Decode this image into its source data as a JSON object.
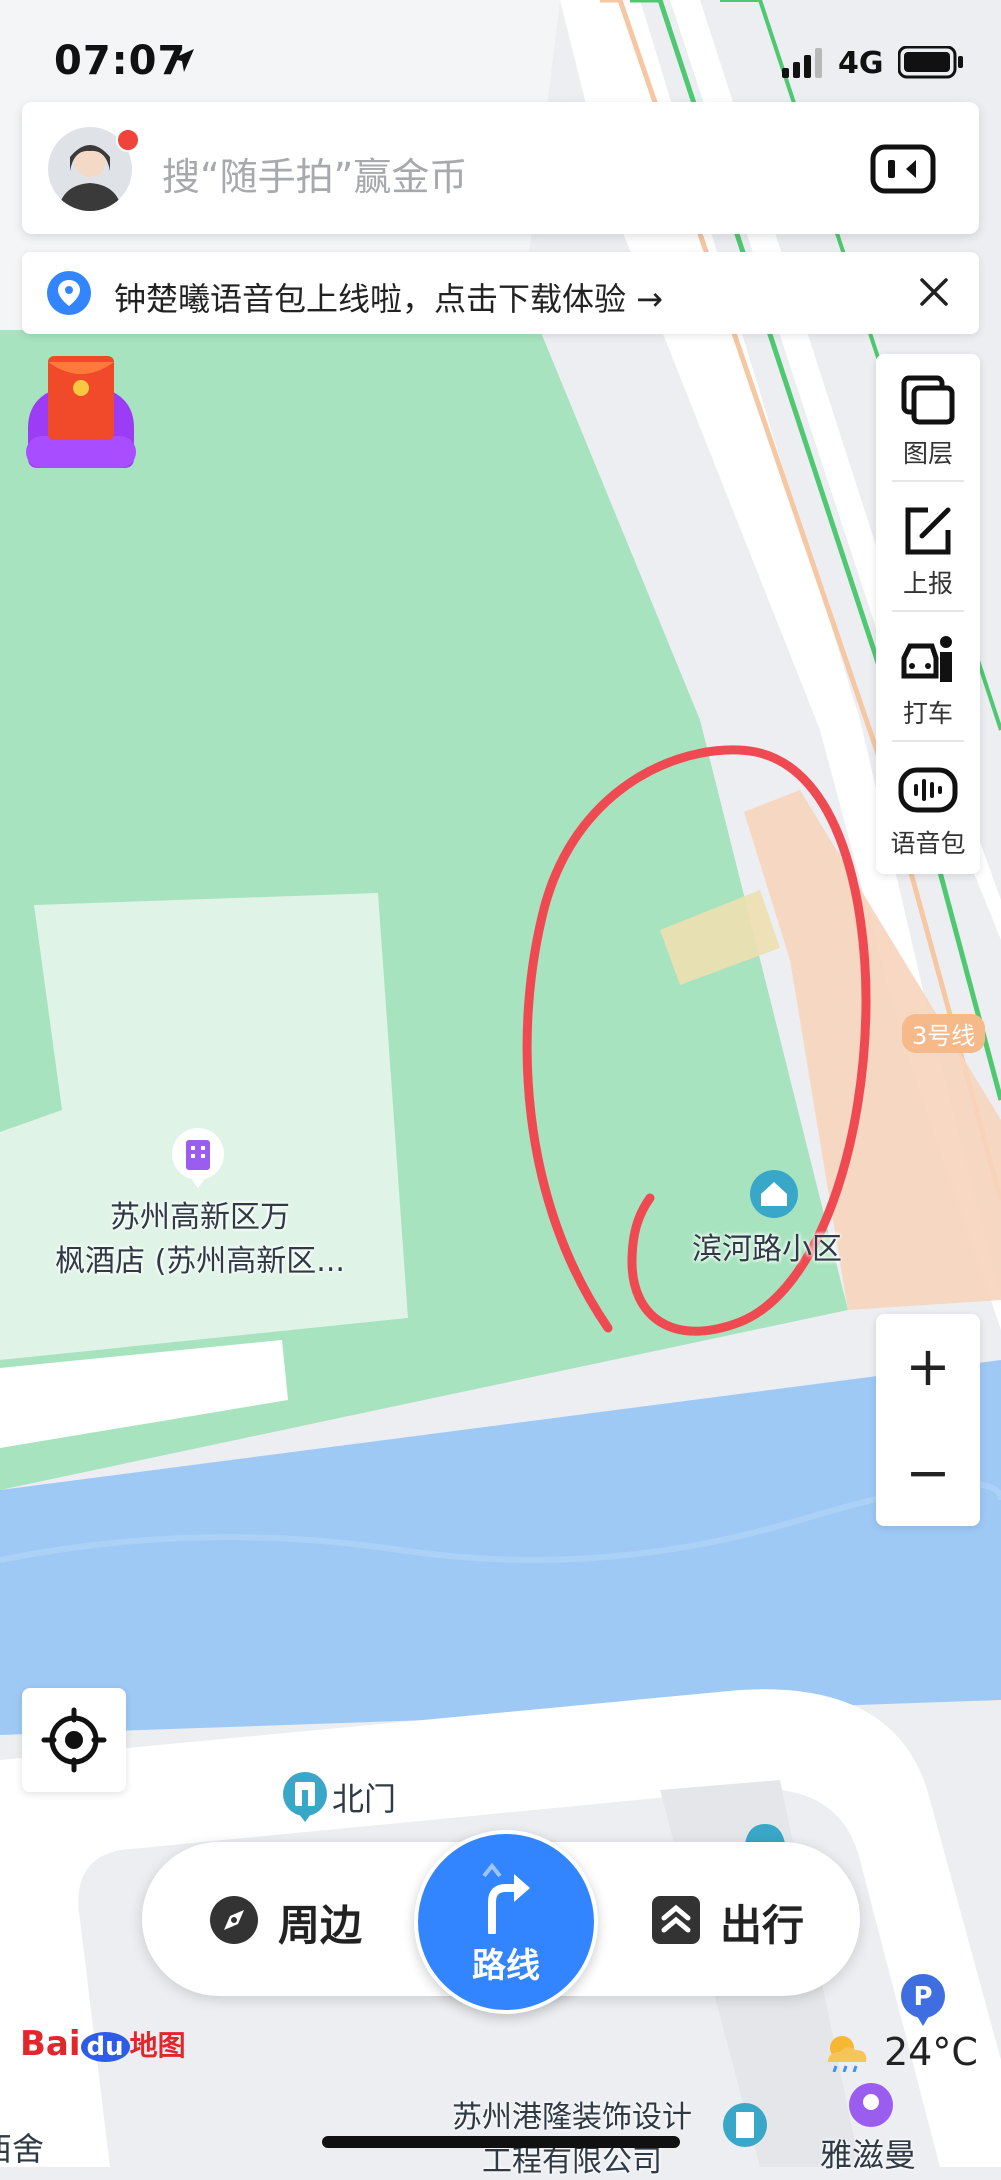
{
  "status_bar": {
    "time": "07:07",
    "network": "4G"
  },
  "search": {
    "placeholder": "搜“随手拍”赢金币"
  },
  "notice": {
    "text": "钟楚曦语音包上线啦，点击下载体验 →"
  },
  "tools": [
    {
      "label": "图层",
      "icon": "layers-icon"
    },
    {
      "label": "上报",
      "icon": "report-icon"
    },
    {
      "label": "打车",
      "icon": "taxi-icon"
    },
    {
      "label": "语音包",
      "icon": "voice-pack-icon"
    }
  ],
  "zoom": {
    "in": "+",
    "out": "−"
  },
  "map": {
    "hotel": {
      "line1": "苏州高新区万",
      "line2": "枫酒店 (苏州高新区..."
    },
    "community": "滨河路小区",
    "line3_badge": "3号线",
    "north_gate": "北门",
    "company": {
      "line1": "苏州港隆装饰设计",
      "line2": "工程有限公司"
    },
    "yazi": "雅滋曼",
    "left_edge": "西舍"
  },
  "bottom_bar": {
    "nearby": "周边",
    "route": "路线",
    "travel": "出行"
  },
  "weather": {
    "temp": "24°C"
  },
  "logo": {
    "bai": "Bai",
    "du": "du",
    "map": "地图"
  },
  "colors": {
    "accent": "#3385ff",
    "park": "#a6e3be",
    "water": "#9ec9f5",
    "annotation": "#ef4a52"
  }
}
